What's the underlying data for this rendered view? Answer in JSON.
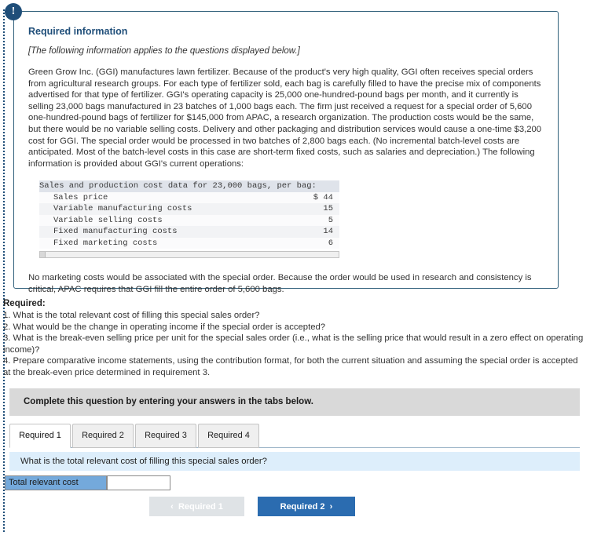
{
  "badge": {
    "icon": "exclamation-icon",
    "glyph": "!"
  },
  "panel": {
    "heading": "Required information",
    "subheading": "[The following information applies to the questions displayed below.]",
    "body_1": "Green Grow Inc. (GGI) manufactures lawn fertilizer. Because of the product's very high quality, GGI often receives special orders from agricultural research groups. For each type of fertilizer sold, each bag is carefully filled to have the precise mix of components advertised for that type of fertilizer. GGI's operating capacity is 25,000 one-hundred-pound bags per month, and it currently is selling 23,000 bags manufactured in 23 batches of 1,000 bags each. The firm just received a request for a special order of 5,600 one-hundred-pound bags of fertilizer for $145,000 from APAC, a research organization. The production costs would be the same, but there would be no variable selling costs. Delivery and other packaging and distribution services would cause a one-time $3,200 cost for GGI. The special order would be processed in two batches of 2,800 bags each. (No incremental batch-level costs are anticipated. Most of the batch-level costs in this case are short-term fixed costs, such as salaries and depreciation.) The following information is provided about GGI's current operations:",
    "body_2": "No marketing costs would be associated with the special order. Because the order would be used in research and consistency is critical, APAC requires that GGI fill the entire order of 5,600 bags."
  },
  "cost_table": {
    "title": "Sales and production cost data for 23,000 bags, per bag:",
    "rows": [
      {
        "label": "Sales price",
        "value": "$ 44"
      },
      {
        "label": "Variable manufacturing costs",
        "value": "15"
      },
      {
        "label": "Variable selling costs",
        "value": "5"
      },
      {
        "label": "Fixed manufacturing costs",
        "value": "14"
      },
      {
        "label": "Fixed marketing costs",
        "value": "6"
      }
    ]
  },
  "required": {
    "label": "Required:",
    "items": [
      "1. What is the total relevant cost of filling this special sales order?",
      "2. What would be the change in operating income if the special order is accepted?",
      "3. What is the break-even selling price per unit for the special sales order (i.e., what is the selling price that would result in a zero effect on operating income)?",
      "4. Prepare comparative income statements, using the contribution format, for both the current situation and assuming the special order is accepted at the break-even price determined in requirement 3."
    ]
  },
  "complete_bar": {
    "text": "Complete this question by entering your answers in the tabs below."
  },
  "tabs": [
    {
      "label": "Required 1",
      "active": true
    },
    {
      "label": "Required 2",
      "active": false
    },
    {
      "label": "Required 3",
      "active": false
    },
    {
      "label": "Required 4",
      "active": false
    }
  ],
  "question_banner": {
    "text": "What is the total relevant cost of filling this special sales order?"
  },
  "answer_row": {
    "label": "Total relevant cost",
    "value": "",
    "placeholder": ""
  },
  "nav": {
    "prev_label": "Required 1",
    "next_label": "Required 2",
    "prev_chevron": "‹",
    "next_chevron": "›"
  },
  "colors": {
    "navy": "#1f4e79",
    "panel_border": "#2f5f7a",
    "banner_blue": "#ddeefb",
    "answer_label_blue": "#74a9db",
    "next_button_blue": "#2b6cb0",
    "prev_button_grey": "#dfe3e6",
    "instruction_grey": "#d9d9d9"
  }
}
